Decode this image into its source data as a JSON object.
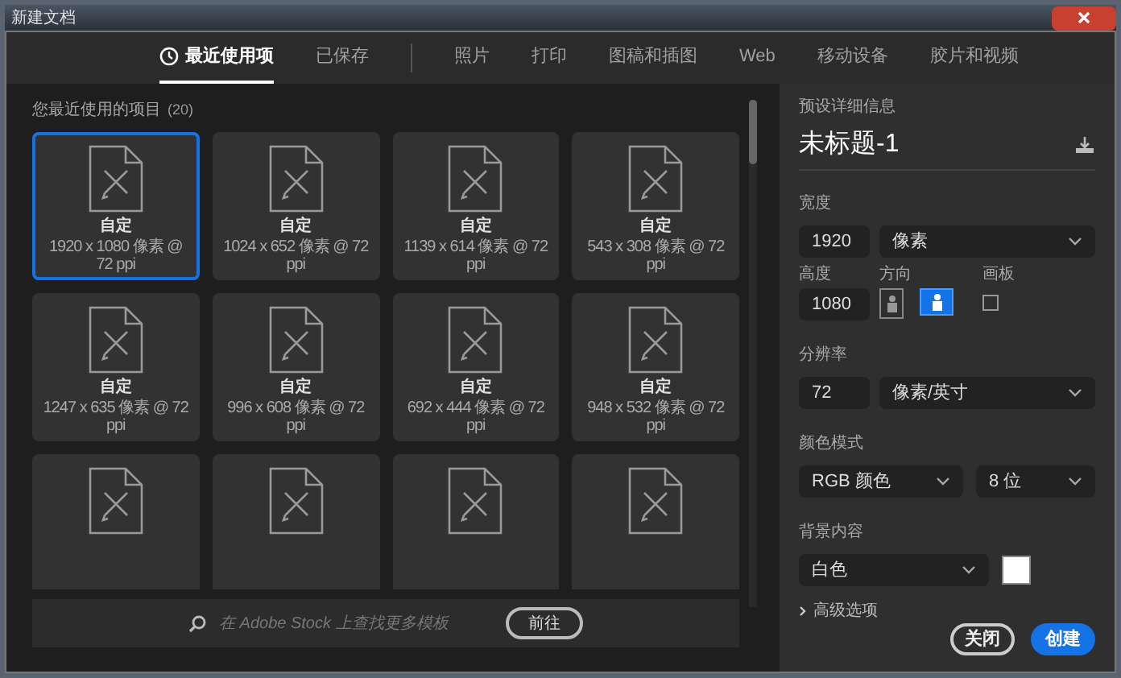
{
  "window": {
    "title": "新建文档"
  },
  "tabs": [
    {
      "label": "最近使用项",
      "selected": true,
      "kind": "recent"
    },
    {
      "label": "已保存",
      "selected": false,
      "kind": "plain"
    },
    {
      "label": "照片",
      "selected": false,
      "kind": "plain"
    },
    {
      "label": "打印",
      "selected": false,
      "kind": "plain"
    },
    {
      "label": "图稿和插图",
      "selected": false,
      "kind": "plain"
    },
    {
      "label": "Web",
      "selected": false,
      "kind": "plain"
    },
    {
      "label": "移动设备",
      "selected": false,
      "kind": "plain"
    },
    {
      "label": "胶片和视频",
      "selected": false,
      "kind": "plain"
    }
  ],
  "recent": {
    "heading": "您最近使用的项目",
    "count": "(20)",
    "items": [
      {
        "title": "自定",
        "size": "1920 x 1080 像素 @ 72 ppi",
        "selected": true
      },
      {
        "title": "自定",
        "size": "1024 x 652 像素 @ 72 ppi",
        "selected": false
      },
      {
        "title": "自定",
        "size": "1139 x 614 像素 @ 72 ppi",
        "selected": false
      },
      {
        "title": "自定",
        "size": "543 x 308 像素 @ 72 ppi",
        "selected": false
      },
      {
        "title": "自定",
        "size": "1247 x 635 像素 @ 72 ppi",
        "selected": false
      },
      {
        "title": "自定",
        "size": "996 x 608 像素 @ 72 ppi",
        "selected": false
      },
      {
        "title": "自定",
        "size": "692 x 444 像素 @ 72 ppi",
        "selected": false
      },
      {
        "title": "自定",
        "size": "948 x 532 像素 @ 72 ppi",
        "selected": false
      },
      {
        "selected": false
      },
      {
        "selected": false
      },
      {
        "selected": false
      },
      {
        "selected": false
      }
    ]
  },
  "stock_search": {
    "placeholder": "在 Adobe Stock 上查找更多模板",
    "button": "前往"
  },
  "details": {
    "heading": "预设详细信息",
    "name": "未标题-1",
    "width": {
      "label": "宽度",
      "value": "1920",
      "unit": "像素"
    },
    "height": {
      "label": "高度",
      "value": "1080"
    },
    "orientation": {
      "label": "方向",
      "options": [
        {
          "kind": "portrait",
          "selected": false
        },
        {
          "kind": "landscape",
          "selected": true
        }
      ]
    },
    "artboard": {
      "label": "画板",
      "checked": false
    },
    "resolution": {
      "label": "分辨率",
      "value": "72",
      "unit": "像素/英寸"
    },
    "color_mode": {
      "label": "颜色模式",
      "mode": "RGB 颜色",
      "depth": "8 位"
    },
    "background": {
      "label": "背景内容",
      "value": "白色",
      "color": "#ffffff"
    },
    "advanced": {
      "label": "高级选项",
      "expanded": false
    }
  },
  "buttons": [
    {
      "label": "关闭",
      "kind": "secondary"
    },
    {
      "label": "创建",
      "kind": "primary"
    }
  ]
}
